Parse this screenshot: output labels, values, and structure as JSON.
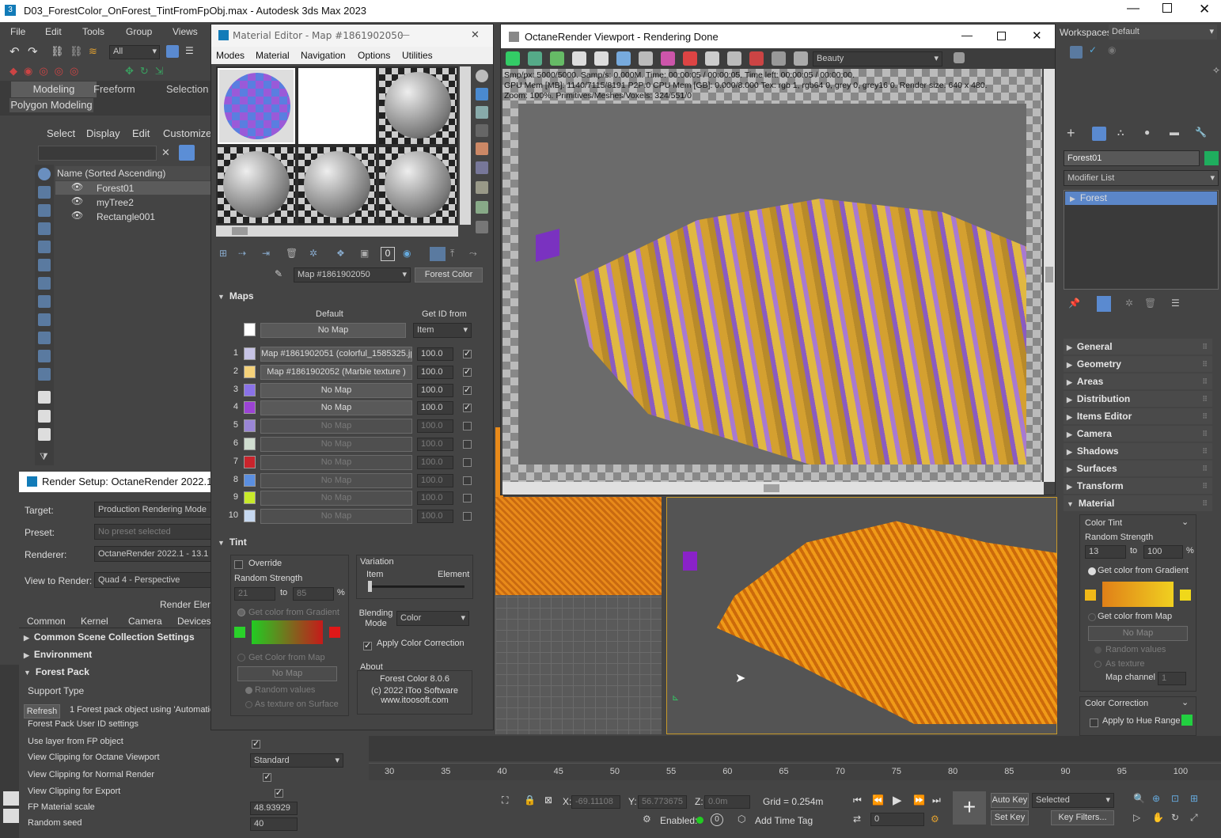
{
  "app": {
    "title": "D03_ForestColor_OnForest_TintFromFpObj.max - Autodesk 3ds Max 2023",
    "workspaces_label": "Workspaces:",
    "workspace": "Default"
  },
  "menu": [
    "File",
    "Edit",
    "Tools",
    "Group",
    "Views"
  ],
  "toolbar": {
    "selection_filter": "All"
  },
  "ribbon": {
    "tabs": [
      "Modeling",
      "Freeform",
      "Selection"
    ],
    "sub": "Polygon Modeling"
  },
  "scene_explorer": {
    "menu": [
      "Select",
      "Display",
      "Edit",
      "Customize"
    ],
    "column": "Name (Sorted Ascending)",
    "items": [
      "Forest01",
      "myTree2",
      "Rectangle001"
    ]
  },
  "render_setup": {
    "title": "Render Setup: OctaneRender 2022.1 - 13.",
    "target_label": "Target:",
    "target": "Production Rendering Mode",
    "preset_label": "Preset:",
    "preset": "No preset selected",
    "renderer_label": "Renderer:",
    "renderer": "OctaneRender 2022.1 - 13.1",
    "view_label": "View to Render:",
    "view": "Quad 4 - Perspective",
    "render_elem": "Render Elem",
    "tabs": [
      "Common",
      "Kernel",
      "Camera",
      "Devices"
    ],
    "rollouts": [
      "Common Scene Collection Settings",
      "Environment",
      "Forest Pack"
    ],
    "support_type": "Support Type",
    "refresh": "Refresh",
    "info": "1 Forest pack object using 'Automatic",
    "rows": [
      {
        "label": "Forest Pack User ID settings"
      },
      {
        "label": "Use layer from FP object",
        "type": "check"
      },
      {
        "label": "View Clipping for Octane Viewport",
        "type": "drop",
        "value": "Standard"
      },
      {
        "label": "View Clipping for Normal Render",
        "type": "check"
      },
      {
        "label": "View Clipping for Export",
        "type": "check"
      },
      {
        "label": "FP Material scale",
        "type": "spin",
        "value": "48.93929"
      },
      {
        "label": "Random seed",
        "type": "spin",
        "value": "40"
      }
    ]
  },
  "material_editor": {
    "title": "Material Editor - Map #1861902050",
    "menu": [
      "Modes",
      "Material",
      "Navigation",
      "Options",
      "Utilities"
    ],
    "map_name": "Map #1861902050",
    "map_type": "Forest Color",
    "maps_title": "Maps",
    "default_label": "Default",
    "getid_label": "Get ID from",
    "default_map": "No Map",
    "getid": "Item",
    "maps": [
      {
        "n": "1",
        "color": "#c7c4e6",
        "name": "Map #1861902051 (colorful_1585325.jp",
        "val": "100.0",
        "on": true,
        "active": true
      },
      {
        "n": "2",
        "color": "#f5d27a",
        "name": "Map #1861902052  (Marble texture )",
        "val": "100.0",
        "on": true,
        "active": true
      },
      {
        "n": "3",
        "color": "#8a72e8",
        "name": "No Map",
        "val": "100.0",
        "on": true,
        "active": true
      },
      {
        "n": "4",
        "color": "#9c43d4",
        "name": "No Map",
        "val": "100.0",
        "on": true,
        "active": true
      },
      {
        "n": "5",
        "color": "#9a86d6",
        "name": "No Map",
        "val": "100.0",
        "on": false,
        "active": false
      },
      {
        "n": "6",
        "color": "#cfdccf",
        "name": "No Map",
        "val": "100.0",
        "on": false,
        "active": false
      },
      {
        "n": "7",
        "color": "#c8242c",
        "name": "No Map",
        "val": "100.0",
        "on": false,
        "active": false
      },
      {
        "n": "8",
        "color": "#5b8fe0",
        "name": "No Map",
        "val": "100.0",
        "on": false,
        "active": false
      },
      {
        "n": "9",
        "color": "#c8ea2a",
        "name": "No Map",
        "val": "100.0",
        "on": false,
        "active": false
      },
      {
        "n": "10",
        "color": "#c6d8f0",
        "name": "No Map",
        "val": "100.0",
        "on": false,
        "active": false
      }
    ],
    "tint": {
      "title": "Tint",
      "override": "Override",
      "random_strength": "Random Strength",
      "from": "21",
      "to_label": "to",
      "to": "85",
      "pct": "%",
      "gradient_opt": "Get color from Gradient",
      "map_opt": "Get Color from Map",
      "no_map": "No Map",
      "random_values": "Random values",
      "as_texture": "As texture on Surface",
      "variation": "Variation",
      "item": "Item",
      "element": "Element",
      "blending_label": "Blending Mode",
      "blending": "Color",
      "apply_cc": "Apply Color Correction",
      "about": "About",
      "about_lines": [
        "Forest Color 8.0.6",
        "(c) 2022 iToo Software",
        "www.itoosoft.com"
      ]
    }
  },
  "octane": {
    "title": "OctaneRender Viewport - Rendering Done",
    "pass": "Beauty",
    "stats": [
      "Smp/px: 5000/5000.   Samp/s: 0.000M.   Time: 00:00:05 / 00:00:05.   Time left: 00:00:05 / 00:00:00.",
      "GPU Mem [MB]: 1140/7115/8191 P2P:0   CPU Mem [GB]: 0.000/8.000   Tex: rgb 1, rgb64 0, grey 0, grey16 0.   Render size: 640 x 480.",
      "Zoom: 100%.   Primitives/Meshes/Voxels: 324/551/0"
    ]
  },
  "command_panel": {
    "object_name": "Forest01",
    "modifier_list": "Modifier List",
    "stack": [
      "Forest"
    ],
    "rollouts": [
      "General",
      "Geometry",
      "Areas",
      "Distribution",
      "Items Editor",
      "Camera",
      "Shadows",
      "Surfaces",
      "Transform",
      "Material"
    ],
    "color_tint": "Color Tint",
    "random_strength": "Random Strength",
    "from": "13",
    "to_label": "to",
    "to": "100",
    "pct": "%",
    "gradient_opt": "Get color from Gradient",
    "map_opt": "Get color from Map",
    "no_map": "No Map",
    "random_values": "Random values",
    "as_texture": "As texture",
    "map_channel": "Map channel",
    "map_channel_val": "1",
    "color_correction": "Color Correction",
    "apply_hue": "Apply to Hue Range"
  },
  "timeline": {
    "ticks": [
      "30",
      "35",
      "40",
      "45",
      "50",
      "55",
      "60",
      "65",
      "70",
      "75",
      "80",
      "85",
      "90",
      "95",
      "100"
    ]
  },
  "status": {
    "x_label": "X:",
    "x": "-69.11108",
    "y_label": "Y:",
    "y": "56.773675",
    "z_label": "Z:",
    "z": "0.0m",
    "grid": "Grid = 0.254m",
    "enabled": "Enabled:",
    "add_time_tag": "Add Time Tag",
    "frame": "0",
    "auto_key": "Auto Key",
    "selected": "Selected",
    "set_key": "Set Key",
    "key_filters": "Key Filters..."
  }
}
